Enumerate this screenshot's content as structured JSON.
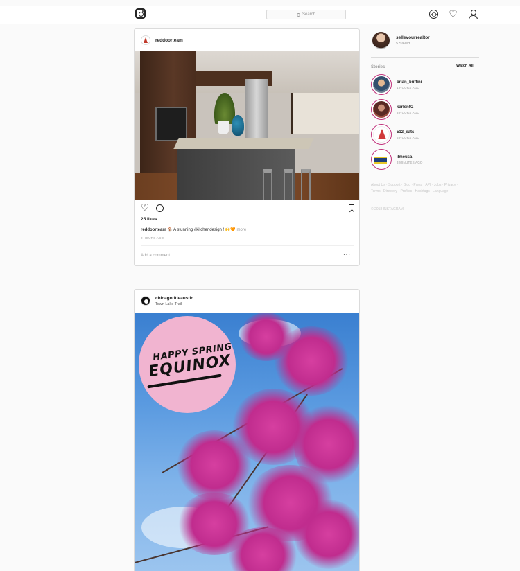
{
  "header": {
    "search_placeholder": "Search"
  },
  "posts": [
    {
      "username": "reddoorteam",
      "likes": "25 likes",
      "caption_user": "reddoorteam",
      "caption_text": "🏠 A stunning #kitchendesign ! 🙌🧡",
      "caption_more": "more",
      "time": "2 HOURS AGO",
      "comment_placeholder": "Add a comment...",
      "more_options": "···"
    },
    {
      "username": "chicagotitleaustin",
      "location": "Town Lake Trail",
      "image_text_small": "HAPPY SPRING",
      "image_text_big": "EQUINOX"
    }
  ],
  "sidebar": {
    "profile_name": "sellevourrealtor",
    "profile_sub": "5 Saved",
    "stories_label": "Stories",
    "watch_all": "Watch All",
    "stories": [
      {
        "name": "brian_buffini",
        "time": "1 HOURS AGO"
      },
      {
        "name": "karlen02",
        "time": "3 HOURS AGO"
      },
      {
        "name": "512_eats",
        "time": "6 HOURS AGO"
      },
      {
        "name": "ilmeusa",
        "time": "3 MINUTES AGO"
      }
    ],
    "footer_links": "About Us · Support · Blog · Press · API · Jobs · Privacy · Terms · Directory · Profiles · Hashtags · Language",
    "copyright": "© 2018 INSTAGRAM"
  },
  "icons": {
    "logo": "instagram-logo-icon",
    "explore": "compass-icon",
    "activity": "heart-icon",
    "profile": "person-icon"
  },
  "colors": {
    "story_ring": "#c0307a",
    "border": "#dbdbdb",
    "background": "#fafafa"
  }
}
